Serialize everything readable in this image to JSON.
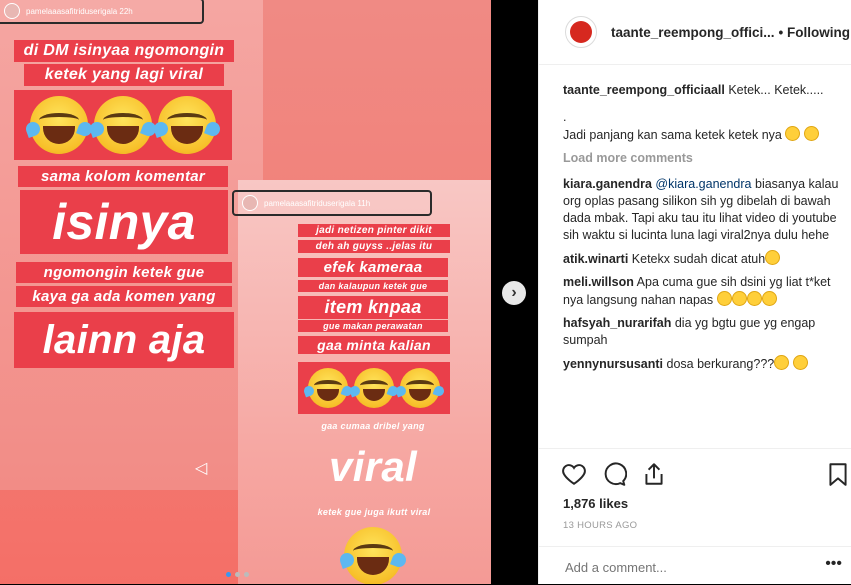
{
  "story": {
    "left_user": "pamelaaasafitriduserigala 22h",
    "right_user": "pamelaaasafitriduserigala 11h",
    "left_captions": [
      "di DM isinyaa ngomongin",
      "ketek yang lagi viral",
      "sama kolom komentar",
      "isinya",
      "ngomongin ketek gue",
      "kaya ga ada komen yang",
      "lainn aja"
    ],
    "right_captions": [
      "jadi netizen pinter dikit",
      "deh ah guyss ..jelas itu",
      "efek kameraa",
      "dan kalaupun ketek gue",
      "item knpaa",
      "gue makan perawatan",
      "gaa minta kalian",
      "gaa cumaa dribel yang",
      "viral",
      "ketek gue juga ikutt viral"
    ],
    "next_icon": "chevron-right-icon",
    "send_icon": "paper-plane-icon"
  },
  "post": {
    "username": "taante_reempong_offici...",
    "follow_label": "• Following",
    "caption_user": "taante_reempong_officiaall",
    "caption_text_1": "Ketek... Ketek.....",
    "caption_text_2": ".",
    "caption_text_3": "Jadi panjang kan sama ketek ketek nya",
    "load_more": "Load more comments",
    "comments": [
      {
        "user": "kiara.ganendra",
        "mention": "@kiara.ganendra",
        "text": "biasanya kalau org oplas pasang silikon sih yg dibelah di bawah dada mbak. Tapi aku tau itu lihat video di youtube sih waktu si lucinta luna lagi viral2nya dulu hehe"
      },
      {
        "user": "atik.winarti",
        "text": "Ketekx sudah dicat atuh"
      },
      {
        "user": "meli.willson",
        "text": "Apa cuma gue sih dsini yg liat t*ket nya langsung nahan napas"
      },
      {
        "user": "hafsyah_nurarifah",
        "text": "dia yg bgtu gue yg engap sumpah"
      },
      {
        "user": "yennynursusanti",
        "text": "dosa berkurang???"
      }
    ],
    "likes": "1,876 likes",
    "timestamp": "13 HOURS AGO",
    "add_comment_placeholder": "Add a comment...",
    "more_label": "•••"
  }
}
